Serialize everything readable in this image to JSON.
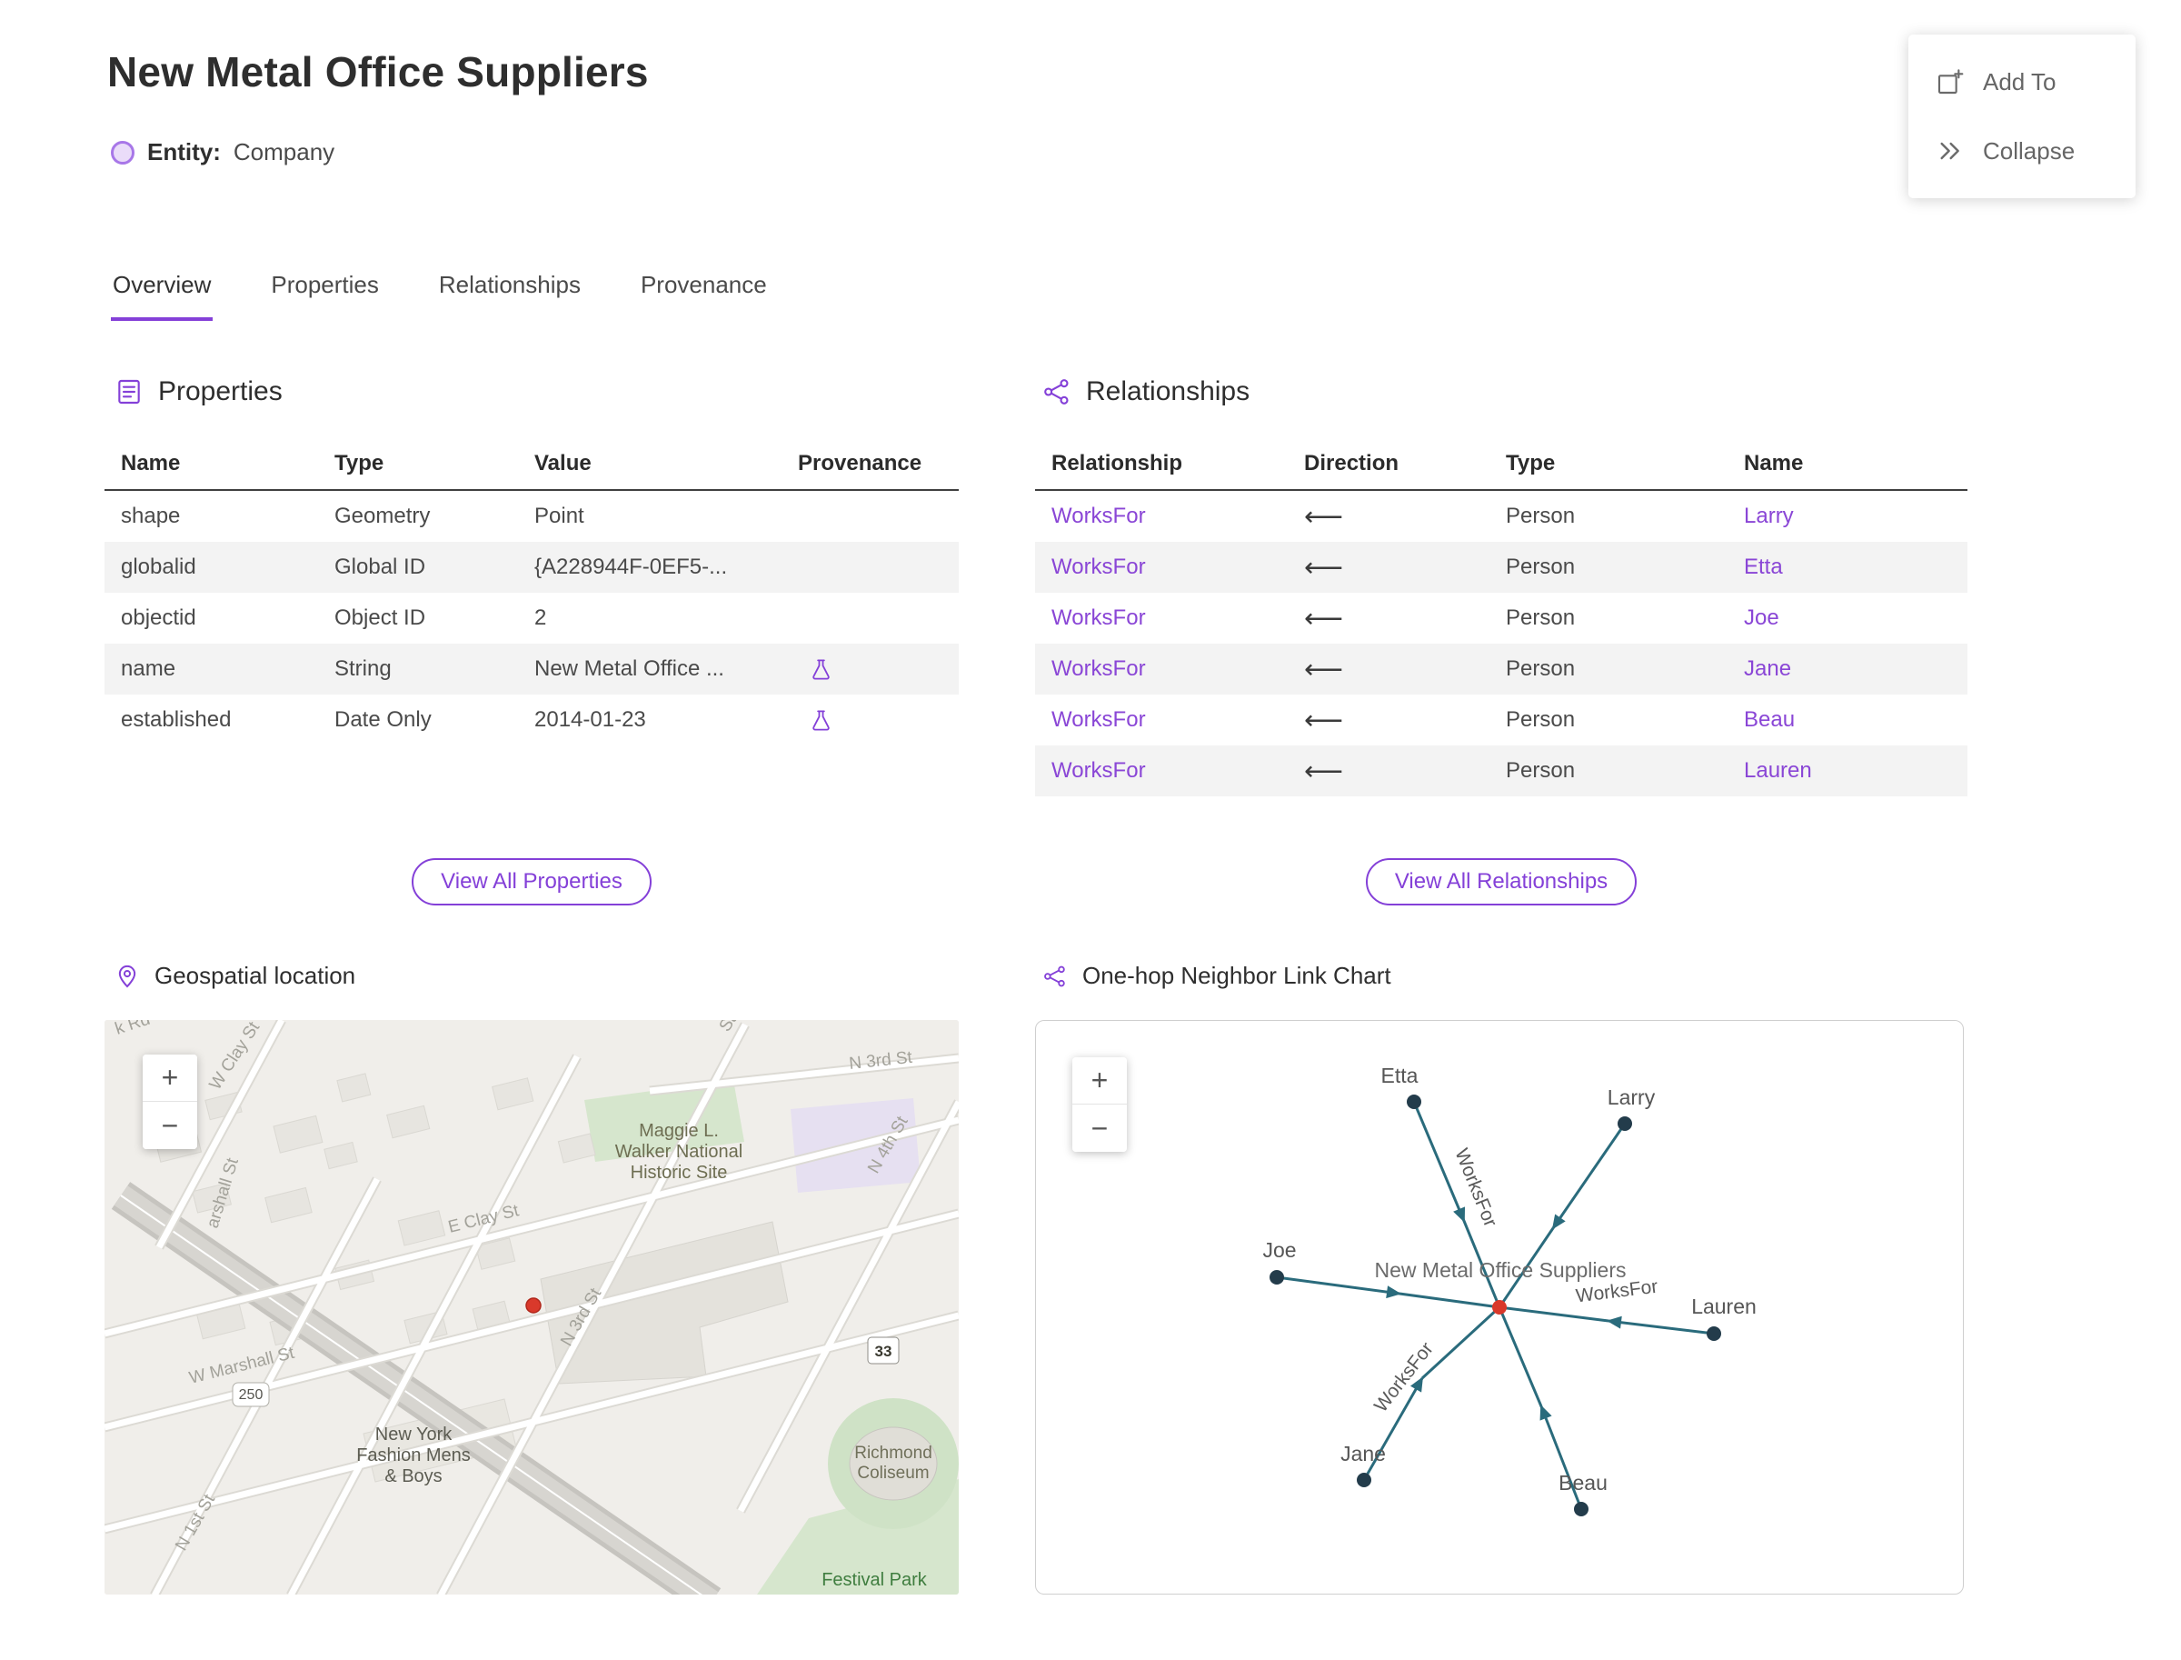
{
  "page": {
    "title": "New Metal Office Suppliers",
    "entity_label": "Entity:",
    "entity_type": "Company"
  },
  "actions": {
    "add_to": "Add To",
    "collapse": "Collapse"
  },
  "tabs": {
    "overview": "Overview",
    "properties": "Properties",
    "relationships": "Relationships",
    "provenance": "Provenance"
  },
  "properties": {
    "title": "Properties",
    "columns": {
      "name": "Name",
      "type": "Type",
      "value": "Value",
      "provenance": "Provenance"
    },
    "rows": [
      {
        "name": "shape",
        "type": "Geometry",
        "value": "Point",
        "provenance": false
      },
      {
        "name": "globalid",
        "type": "Global ID",
        "value": "{A228944F-0EF5-...",
        "provenance": false
      },
      {
        "name": "objectid",
        "type": "Object ID",
        "value": "2",
        "provenance": false
      },
      {
        "name": "name",
        "type": "String",
        "value": "New Metal Office ...",
        "provenance": true
      },
      {
        "name": "established",
        "type": "Date Only",
        "value": "2014-01-23",
        "provenance": true
      }
    ],
    "view_all": "View All Properties"
  },
  "relationships": {
    "title": "Relationships",
    "columns": {
      "relationship": "Relationship",
      "direction": "Direction",
      "type": "Type",
      "name": "Name"
    },
    "rows": [
      {
        "relationship": "WorksFor",
        "direction": "⟵",
        "type": "Person",
        "name": "Larry"
      },
      {
        "relationship": "WorksFor",
        "direction": "⟵",
        "type": "Person",
        "name": "Etta"
      },
      {
        "relationship": "WorksFor",
        "direction": "⟵",
        "type": "Person",
        "name": "Joe"
      },
      {
        "relationship": "WorksFor",
        "direction": "⟵",
        "type": "Person",
        "name": "Jane"
      },
      {
        "relationship": "WorksFor",
        "direction": "⟵",
        "type": "Person",
        "name": "Beau"
      },
      {
        "relationship": "WorksFor",
        "direction": "⟵",
        "type": "Person",
        "name": "Lauren"
      }
    ],
    "view_all": "View All Relationships"
  },
  "map": {
    "title": "Geospatial location",
    "zoom_in": "+",
    "zoom_out": "−",
    "labels": {
      "brook_rd": "k Rd",
      "w_clay": "W Clay St",
      "sa": "Sa",
      "n3rd_top": "N 3rd St",
      "n4th": "N 4th St",
      "maggie1": "Maggie L.",
      "maggie2": "Walker National",
      "maggie3": "Historic Site",
      "marshall": "arshall St",
      "w_marshall": "W Marshall St",
      "e_clay": "E Clay St",
      "n3rd": "N 3rd St",
      "n1st": "N 1st St",
      "shield_250": "250",
      "shield_33": "33",
      "nyf1": "New York",
      "nyf2": "Fashion Mens",
      "nyf3": "& Boys",
      "col1": "Richmond",
      "col2": "Coliseum",
      "festival": "Festival Park"
    }
  },
  "link_chart": {
    "title": "One-hop Neighbor Link Chart",
    "zoom_in": "+",
    "zoom_out": "−",
    "center_label": "New Metal Office Suppliers",
    "edge_label": "WorksFor",
    "nodes": [
      "Etta",
      "Larry",
      "Joe",
      "Lauren",
      "Jane",
      "Beau"
    ]
  },
  "colors": {
    "accent_purple": "#8440d8",
    "link_purple": "#8a46d6",
    "row_stripe": "#f3f3f3",
    "graph_edge_teal": "#2a6b7c",
    "graph_node_dark": "#233c4b",
    "graph_center_red": "#d9392b",
    "map_marker_red": "#d9392b"
  }
}
